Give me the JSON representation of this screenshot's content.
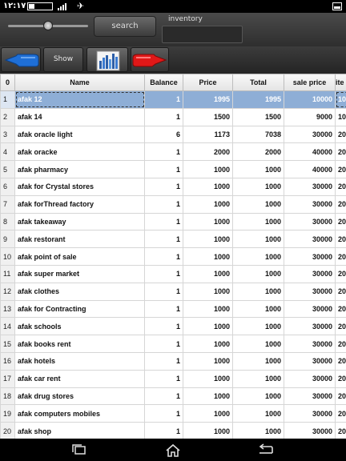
{
  "status_bar": {
    "time": "١٢:١٧",
    "battery": "٩٦"
  },
  "top_panel": {
    "slider_level_percent": 50,
    "search_label": "search",
    "inventory_label": "inventory",
    "inventory_value": ""
  },
  "toolbar": {
    "show_label": "Show"
  },
  "table": {
    "headers": [
      "0",
      "Name",
      "Balance",
      "Price",
      "Total",
      "sale price",
      "ite"
    ],
    "selected_row": 0,
    "rows": [
      {
        "idx": "1",
        "name": "afak 12",
        "balance": "1",
        "price": "1995",
        "total": "1995",
        "sale": "10000",
        "extra": "10"
      },
      {
        "idx": "2",
        "name": "afak 14",
        "balance": "1",
        "price": "1500",
        "total": "1500",
        "sale": "9000",
        "extra": "10"
      },
      {
        "idx": "3",
        "name": "afak oracle light",
        "balance": "6",
        "price": "1173",
        "total": "7038",
        "sale": "30000",
        "extra": "20"
      },
      {
        "idx": "4",
        "name": "afak oracke",
        "balance": "1",
        "price": "2000",
        "total": "2000",
        "sale": "40000",
        "extra": "20"
      },
      {
        "idx": "5",
        "name": "afak pharmacy",
        "balance": "1",
        "price": "1000",
        "total": "1000",
        "sale": "40000",
        "extra": "20"
      },
      {
        "idx": "6",
        "name": "afak for Crystal stores",
        "balance": "1",
        "price": "1000",
        "total": "1000",
        "sale": "30000",
        "extra": "20"
      },
      {
        "idx": "7",
        "name": "afak forThread factory",
        "balance": "1",
        "price": "1000",
        "total": "1000",
        "sale": "30000",
        "extra": "20"
      },
      {
        "idx": "8",
        "name": "afak takeaway",
        "balance": "1",
        "price": "1000",
        "total": "1000",
        "sale": "30000",
        "extra": "20"
      },
      {
        "idx": "9",
        "name": "afak restorant",
        "balance": "1",
        "price": "1000",
        "total": "1000",
        "sale": "30000",
        "extra": "20"
      },
      {
        "idx": "10",
        "name": "afak point of sale",
        "balance": "1",
        "price": "1000",
        "total": "1000",
        "sale": "30000",
        "extra": "20"
      },
      {
        "idx": "11",
        "name": "afak super market",
        "balance": "1",
        "price": "1000",
        "total": "1000",
        "sale": "30000",
        "extra": "20"
      },
      {
        "idx": "12",
        "name": "afak clothes",
        "balance": "1",
        "price": "1000",
        "total": "1000",
        "sale": "30000",
        "extra": "20"
      },
      {
        "idx": "13",
        "name": "afak for Contracting",
        "balance": "1",
        "price": "1000",
        "total": "1000",
        "sale": "30000",
        "extra": "20"
      },
      {
        "idx": "14",
        "name": "afak schools",
        "balance": "1",
        "price": "1000",
        "total": "1000",
        "sale": "30000",
        "extra": "20"
      },
      {
        "idx": "15",
        "name": "afak books rent",
        "balance": "1",
        "price": "1000",
        "total": "1000",
        "sale": "30000",
        "extra": "20"
      },
      {
        "idx": "16",
        "name": "afak hotels",
        "balance": "1",
        "price": "1000",
        "total": "1000",
        "sale": "30000",
        "extra": "20"
      },
      {
        "idx": "17",
        "name": "afak car rent",
        "balance": "1",
        "price": "1000",
        "total": "1000",
        "sale": "30000",
        "extra": "20"
      },
      {
        "idx": "18",
        "name": "afak drug stores",
        "balance": "1",
        "price": "1000",
        "total": "1000",
        "sale": "30000",
        "extra": "20"
      },
      {
        "idx": "19",
        "name": "afak computers mobiles",
        "balance": "1",
        "price": "1000",
        "total": "1000",
        "sale": "30000",
        "extra": "20"
      },
      {
        "idx": "20",
        "name": "afak shop",
        "balance": "1",
        "price": "1000",
        "total": "1000",
        "sale": "30000",
        "extra": "20"
      }
    ]
  },
  "colors": {
    "selected_row": "#8eaed6",
    "left_hand": "#1f6fd6",
    "right_hand": "#e01818"
  },
  "icons": {
    "left_button": "hand-pointing-left-icon",
    "chart_button": "bar-chart-icon",
    "right_button": "hand-pointing-right-icon",
    "nav_recent": "recent-apps-icon",
    "nav_home": "home-icon",
    "nav_back": "back-icon"
  }
}
